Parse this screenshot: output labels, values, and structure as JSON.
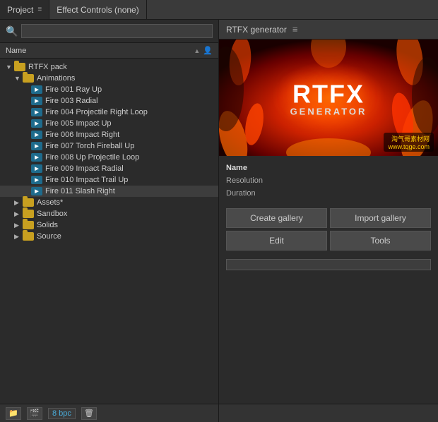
{
  "panels": {
    "project": {
      "tab_label": "Project",
      "menu_icon": "≡",
      "effect_controls": "Effect Controls (none)"
    },
    "rtfx": {
      "tab_label": "RTFX generator",
      "menu_icon": "≡"
    }
  },
  "project_panel": {
    "search_placeholder": "🔍",
    "column_name": "Name",
    "root_folder": "RTFX pack",
    "tree": [
      {
        "id": "rtfx-pack",
        "label": "RTFX pack",
        "type": "folder",
        "level": 1,
        "open": true
      },
      {
        "id": "animations",
        "label": "Animations",
        "type": "folder",
        "level": 2,
        "open": true
      },
      {
        "id": "fire001",
        "label": "Fire 001 Ray Up",
        "type": "comp",
        "level": 3
      },
      {
        "id": "fire003",
        "label": "Fire 003 Radial",
        "type": "comp",
        "level": 3
      },
      {
        "id": "fire004",
        "label": "Fire 004 Projectile Right Loop",
        "type": "comp",
        "level": 3
      },
      {
        "id": "fire005",
        "label": "Fire 005 Impact Up",
        "type": "comp",
        "level": 3
      },
      {
        "id": "fire006",
        "label": "Fire 006 Impact Right",
        "type": "comp",
        "level": 3
      },
      {
        "id": "fire007",
        "label": "Fire 007 Torch Fireball Up",
        "type": "comp",
        "level": 3
      },
      {
        "id": "fire008",
        "label": "Fire 008 Up Projectile Loop",
        "type": "comp",
        "level": 3
      },
      {
        "id": "fire009",
        "label": "Fire 009 Impact Radial",
        "type": "comp",
        "level": 3
      },
      {
        "id": "fire010",
        "label": "Fire 010 Impact Trail Up",
        "type": "comp",
        "level": 3
      },
      {
        "id": "fire011",
        "label": "Fire 011 Slash Right",
        "type": "comp",
        "level": 3
      },
      {
        "id": "assets",
        "label": "Assets*",
        "type": "folder",
        "level": 2,
        "open": false
      },
      {
        "id": "sandbox",
        "label": "Sandbox",
        "type": "folder",
        "level": 2,
        "open": false
      },
      {
        "id": "solids",
        "label": "Solids",
        "type": "folder",
        "level": 2,
        "open": false
      },
      {
        "id": "source",
        "label": "Source",
        "type": "folder",
        "level": 2,
        "open": false
      }
    ]
  },
  "rtfx_panel": {
    "logo_rtfx": "RTFX",
    "logo_generator": "GENERATOR",
    "info": {
      "name_label": "Name",
      "resolution_label": "Resolution",
      "duration_label": "Duration"
    },
    "buttons": {
      "create_gallery": "Create gallery",
      "import_gallery": "Import gallery",
      "edit": "Edit",
      "tools": "Tools"
    }
  },
  "bottom_bar": {
    "bpc": "8 bpc"
  },
  "watermark": {
    "line1": "淘气哥素材网",
    "line2": "www.tqge.com"
  }
}
